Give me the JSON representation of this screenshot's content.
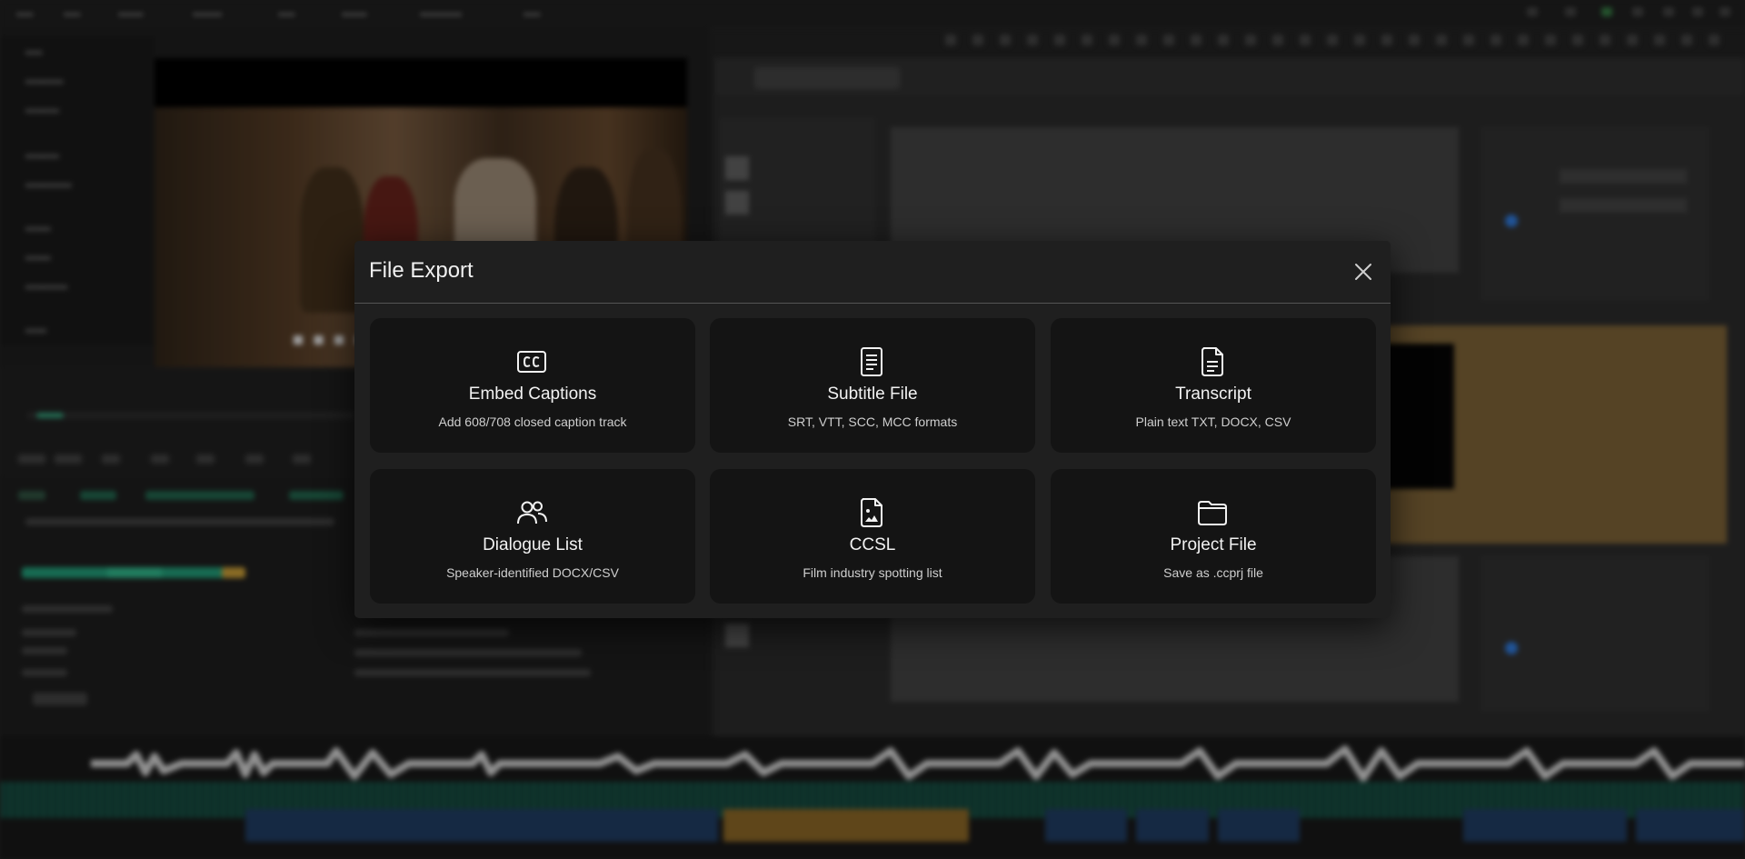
{
  "dialog": {
    "title": "File Export",
    "close_label": "close",
    "options": [
      {
        "title": "Embed Captions",
        "description": "Add 608/708 closed caption track",
        "icon": "closed-captions-icon"
      },
      {
        "title": "Subtitle File",
        "description": "SRT, VTT, SCC, MCC formats",
        "icon": "document-lines-icon"
      },
      {
        "title": "Transcript",
        "description": "Plain text TXT, DOCX, CSV",
        "icon": "document-text-icon"
      },
      {
        "title": "Dialogue List",
        "description": "Speaker-identified DOCX/CSV",
        "icon": "users-icon"
      },
      {
        "title": "CCSL",
        "description": "Film industry spotting list",
        "icon": "document-image-icon"
      },
      {
        "title": "Project File",
        "description": "Save as .ccprj file",
        "icon": "folder-icon"
      }
    ]
  },
  "colors": {
    "dialog_bg": "#1f1f1f",
    "card_bg": "#141414",
    "divider": "#555555",
    "text_primary": "#f2f2f2",
    "text_secondary": "#cfcfcf"
  }
}
